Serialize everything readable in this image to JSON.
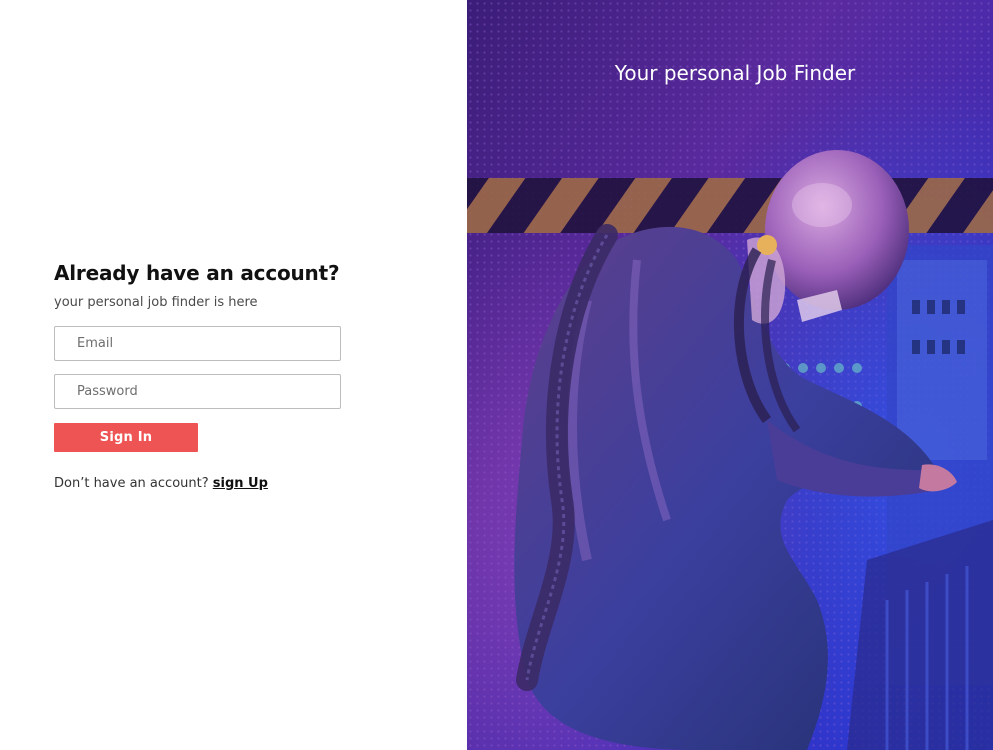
{
  "login": {
    "heading": "Already have an account?",
    "subheading": "your personal job finder is here",
    "email_placeholder": "Email",
    "password_placeholder": "Password",
    "sign_in_label": "Sign In",
    "signup_prompt": "Don’t have an account?",
    "signup_link_label": "sign Up"
  },
  "hero": {
    "tagline": "Your personal Job Finder",
    "image_subject": "astronaut-photo"
  },
  "colors": {
    "accent": "#ef5454",
    "hero_purple": "#5a2a9e",
    "hero_blue": "#2a3dd6"
  }
}
